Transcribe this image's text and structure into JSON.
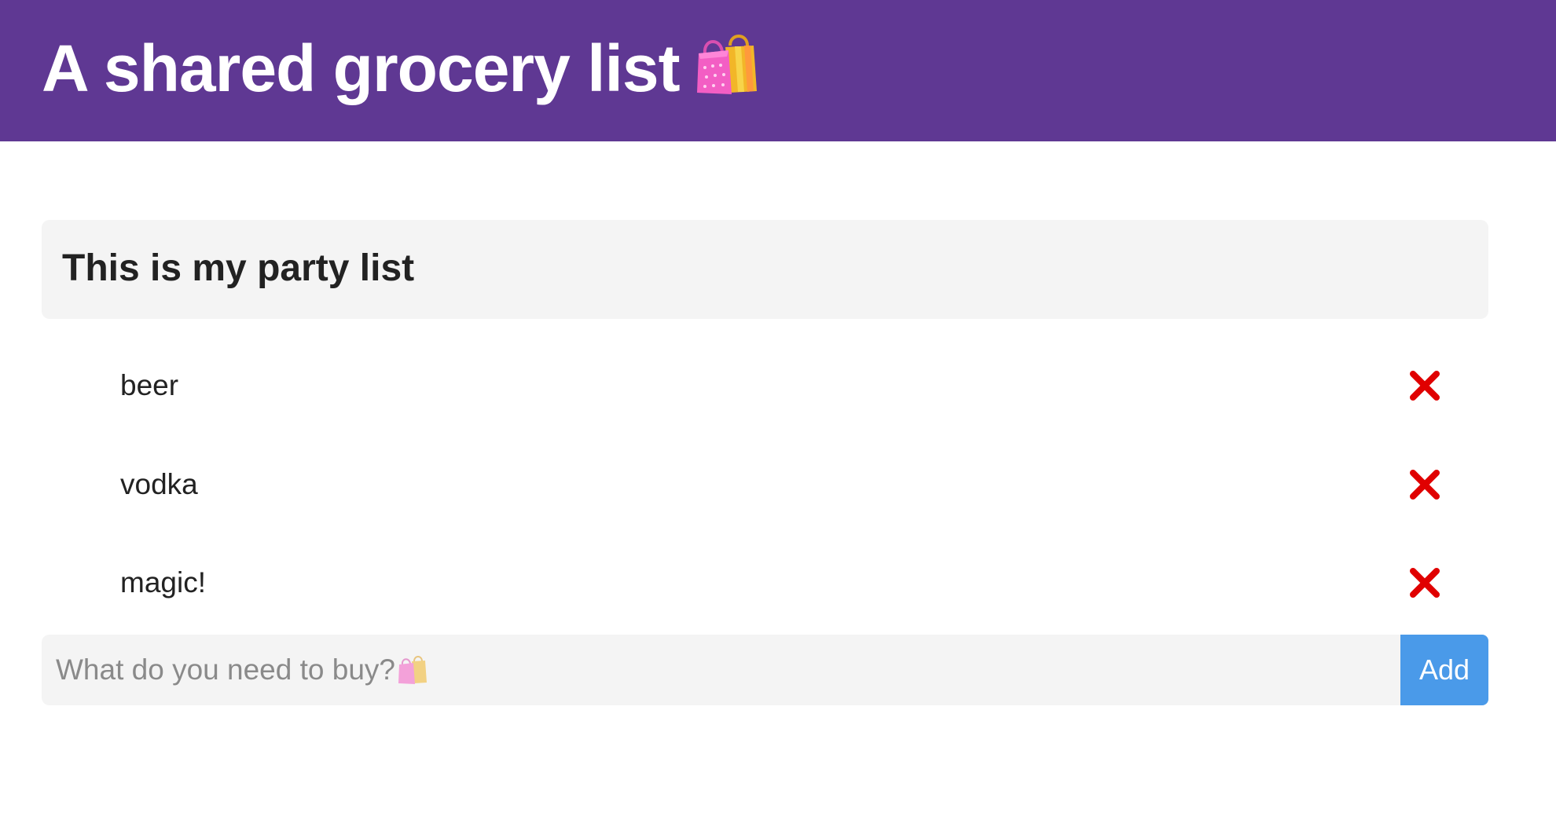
{
  "header": {
    "title": "A shared grocery list",
    "icon": "shopping-bags-icon",
    "background_color": "#5f3893"
  },
  "list": {
    "title": "This is my party list",
    "items": [
      {
        "label": "beer",
        "delete_icon": "close-icon"
      },
      {
        "label": "vodka",
        "delete_icon": "close-icon"
      },
      {
        "label": "magic!",
        "delete_icon": "close-icon"
      }
    ],
    "delete_color": "#e00000"
  },
  "add_form": {
    "placeholder": "What do you need to buy?",
    "value": "",
    "button_label": "Add",
    "button_color": "#4a9ae9",
    "placeholder_icon": "shopping-bags-icon"
  }
}
